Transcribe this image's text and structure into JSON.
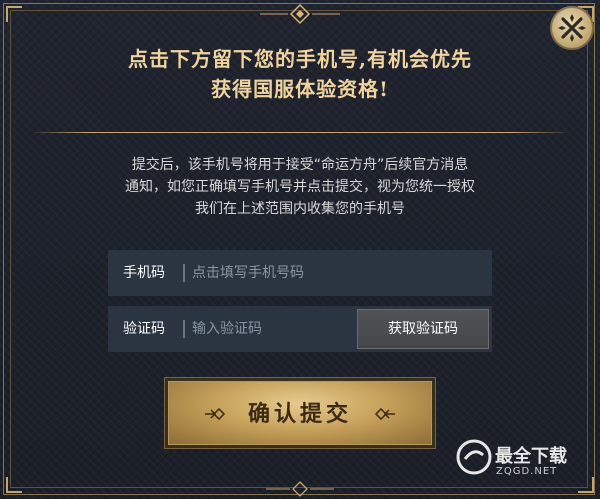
{
  "dialog": {
    "title_line1": "点击下方留下您的手机号,有机会优先",
    "title_line2": "获得国服体验资格!",
    "desc_line1": "提交后，该手机号将用于接受“命运方舟”后续官方消息",
    "desc_line2": "通知，如您正确填写手机号并点击提交，视为您统一授权",
    "desc_line3": "我们在上述范围内收集您的手机号",
    "close_icon": "close-x-icon"
  },
  "form": {
    "phone": {
      "label": "手机码",
      "placeholder": "点击填写手机号码",
      "value": ""
    },
    "code": {
      "label": "验证码",
      "placeholder": "输入验证码",
      "value": "",
      "button_label": "获取验证码"
    },
    "submit_label": "确认提交"
  },
  "watermark": {
    "title": "最全下载",
    "url": "ZQGD.NET"
  },
  "colors": {
    "gold": "#c9a66a",
    "title_gold": "#f0d49b",
    "field_bg": "#2b3441"
  }
}
